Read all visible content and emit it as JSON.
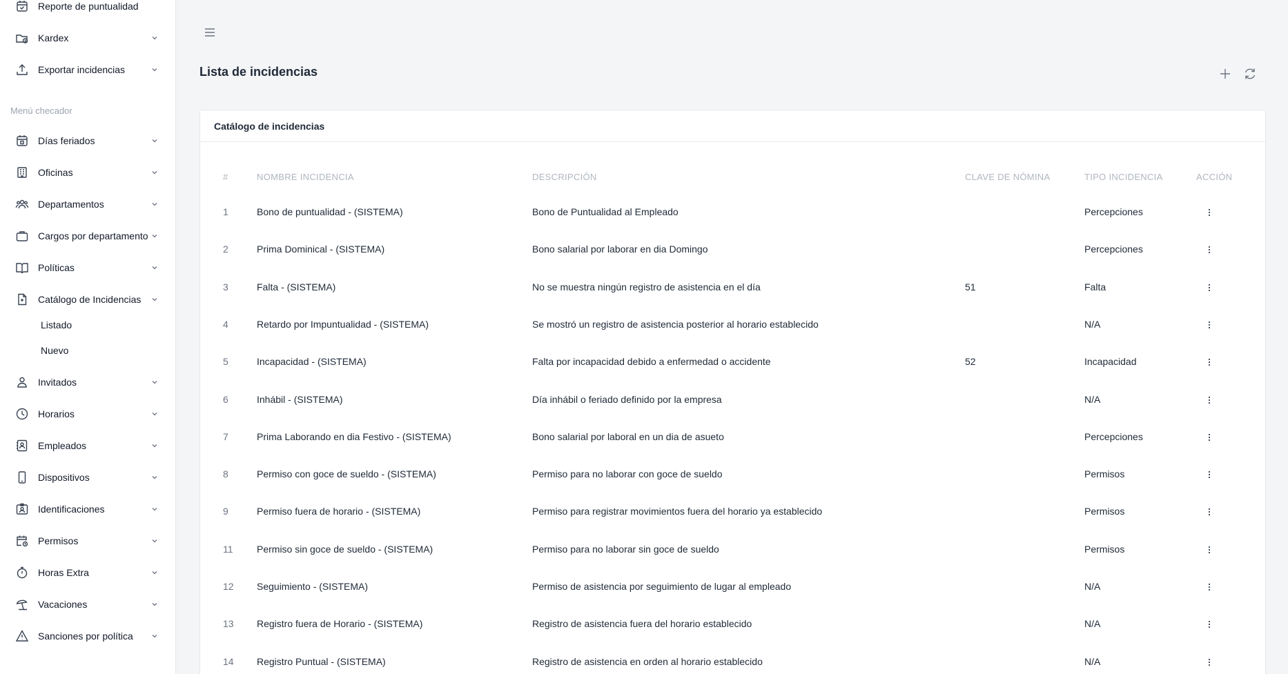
{
  "sidebar": {
    "top_items": [
      {
        "label": "Reporte de puntualidad",
        "icon": "calendar-check-icon"
      },
      {
        "label": "Kardex",
        "icon": "folder-clock-icon"
      },
      {
        "label": "Exportar incidencias",
        "icon": "upload-icon"
      }
    ],
    "section_title": "Menú checador",
    "items": [
      {
        "label": "Días feriados",
        "icon": "calendar-star-icon"
      },
      {
        "label": "Oficinas",
        "icon": "building-icon"
      },
      {
        "label": "Departamentos",
        "icon": "users-icon"
      },
      {
        "label": "Cargos por departamento",
        "icon": "briefcase-icon"
      },
      {
        "label": "Políticas",
        "icon": "book-open-icon"
      },
      {
        "label": "Catálogo de Incidencias",
        "icon": "document-icon"
      },
      {
        "label": "Invitados",
        "icon": "guest-user-icon"
      },
      {
        "label": "Horarios",
        "icon": "clock-icon"
      },
      {
        "label": "Empleados",
        "icon": "contact-card-icon"
      },
      {
        "label": "Dispositivos",
        "icon": "phone-icon"
      },
      {
        "label": "Identificaciones",
        "icon": "id-badge-icon"
      },
      {
        "label": "Permisos",
        "icon": "calendar-clock-icon"
      },
      {
        "label": "Horas Extra",
        "icon": "stopwatch-icon"
      },
      {
        "label": "Vacaciones",
        "icon": "beach-umbrella-icon"
      },
      {
        "label": "Sanciones por política",
        "icon": "warning-icon"
      }
    ],
    "sub_items": [
      "Listado",
      "Nuevo"
    ]
  },
  "page": {
    "title": "Lista de incidencias",
    "card_title": "Catálogo de incidencias"
  },
  "table": {
    "headers": [
      "#",
      "NOMBRE INCIDENCIA",
      "DESCRIPCIÓN",
      "CLAVE DE NÓMINA",
      "TIPO INCIDENCIA",
      "ACCIÓN"
    ],
    "rows": [
      {
        "num": "1",
        "name": "Bono de puntualidad - (SISTEMA)",
        "desc": "Bono de Puntualidad al Empleado",
        "clave": "",
        "tipo": "Percepciones"
      },
      {
        "num": "2",
        "name": "Prima Dominical - (SISTEMA)",
        "desc": "Bono salarial por laborar en dia Domingo",
        "clave": "",
        "tipo": "Percepciones"
      },
      {
        "num": "3",
        "name": "Falta - (SISTEMA)",
        "desc": "No se muestra ningún registro de asistencia en el día",
        "clave": "51",
        "tipo": "Falta"
      },
      {
        "num": "4",
        "name": "Retardo por Impuntualidad - (SISTEMA)",
        "desc": "Se mostró un registro de asistencia posterior al horario establecido",
        "clave": "",
        "tipo": "N/A"
      },
      {
        "num": "5",
        "name": "Incapacidad - (SISTEMA)",
        "desc": "Falta por incapacidad debido a enfermedad o accidente",
        "clave": "52",
        "tipo": "Incapacidad"
      },
      {
        "num": "6",
        "name": "Inhábil - (SISTEMA)",
        "desc": "Día inhábil o feriado definido por la empresa",
        "clave": "",
        "tipo": "N/A"
      },
      {
        "num": "7",
        "name": "Prima Laborando en dia Festivo - (SISTEMA)",
        "desc": "Bono salarial por laboral en un dia de asueto",
        "clave": "",
        "tipo": "Percepciones"
      },
      {
        "num": "8",
        "name": "Permiso con goce de sueldo - (SISTEMA)",
        "desc": "Permiso para no laborar con goce de sueldo",
        "clave": "",
        "tipo": "Permisos"
      },
      {
        "num": "9",
        "name": "Permiso fuera de horario - (SISTEMA)",
        "desc": "Permiso para registrar movimientos fuera del horario ya establecido",
        "clave": "",
        "tipo": "Permisos"
      },
      {
        "num": "11",
        "name": "Permiso sin goce de sueldo - (SISTEMA)",
        "desc": "Permiso para no laborar sin goce de sueldo",
        "clave": "",
        "tipo": "Permisos"
      },
      {
        "num": "12",
        "name": "Seguimiento - (SISTEMA)",
        "desc": "Permiso de asistencia por seguimiento de lugar al empleado",
        "clave": "",
        "tipo": "N/A"
      },
      {
        "num": "13",
        "name": "Registro fuera de Horario - (SISTEMA)",
        "desc": "Registro de asistencia fuera del horario establecido",
        "clave": "",
        "tipo": "N/A"
      },
      {
        "num": "14",
        "name": "Registro Puntual - (SISTEMA)",
        "desc": "Registro de asistencia en orden al horario establecido",
        "clave": "",
        "tipo": "N/A"
      }
    ]
  }
}
